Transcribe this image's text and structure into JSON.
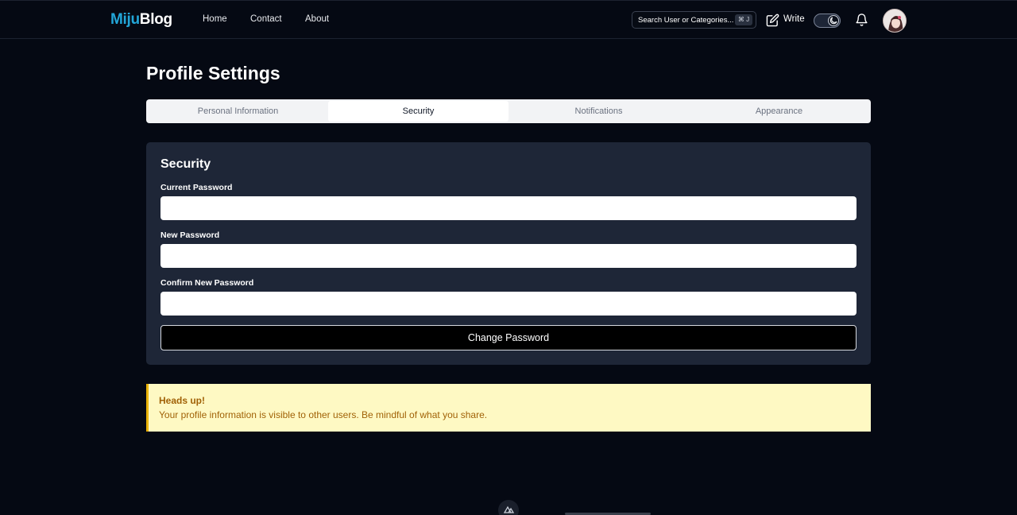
{
  "header": {
    "logo_part1": "Miju",
    "logo_part2": "Blog",
    "nav": [
      "Home",
      "Contact",
      "About"
    ],
    "search_placeholder": "Search User or Categories...",
    "search_shortcut": "⌘ J",
    "write_label": "Write"
  },
  "page": {
    "title": "Profile Settings",
    "tabs": [
      "Personal Information",
      "Security",
      "Notifications",
      "Appearance"
    ],
    "active_tab": "Security"
  },
  "security": {
    "heading": "Security",
    "current_password_label": "Current Password",
    "new_password_label": "New Password",
    "confirm_password_label": "Confirm New Password",
    "submit_label": "Change Password"
  },
  "alert": {
    "title": "Heads up!",
    "message": "Your profile information is visible to other users. Be mindful of what you share."
  },
  "colors": {
    "background": "#050913",
    "accent": "#22a6d8",
    "card": "#1e2637",
    "alert_bg": "#fef9c3",
    "alert_text": "#a16207"
  },
  "icons": [
    "edit-icon",
    "theme-toggle-moon-icon",
    "bell-icon",
    "avatar",
    "nuxt-devtools-icon"
  ]
}
